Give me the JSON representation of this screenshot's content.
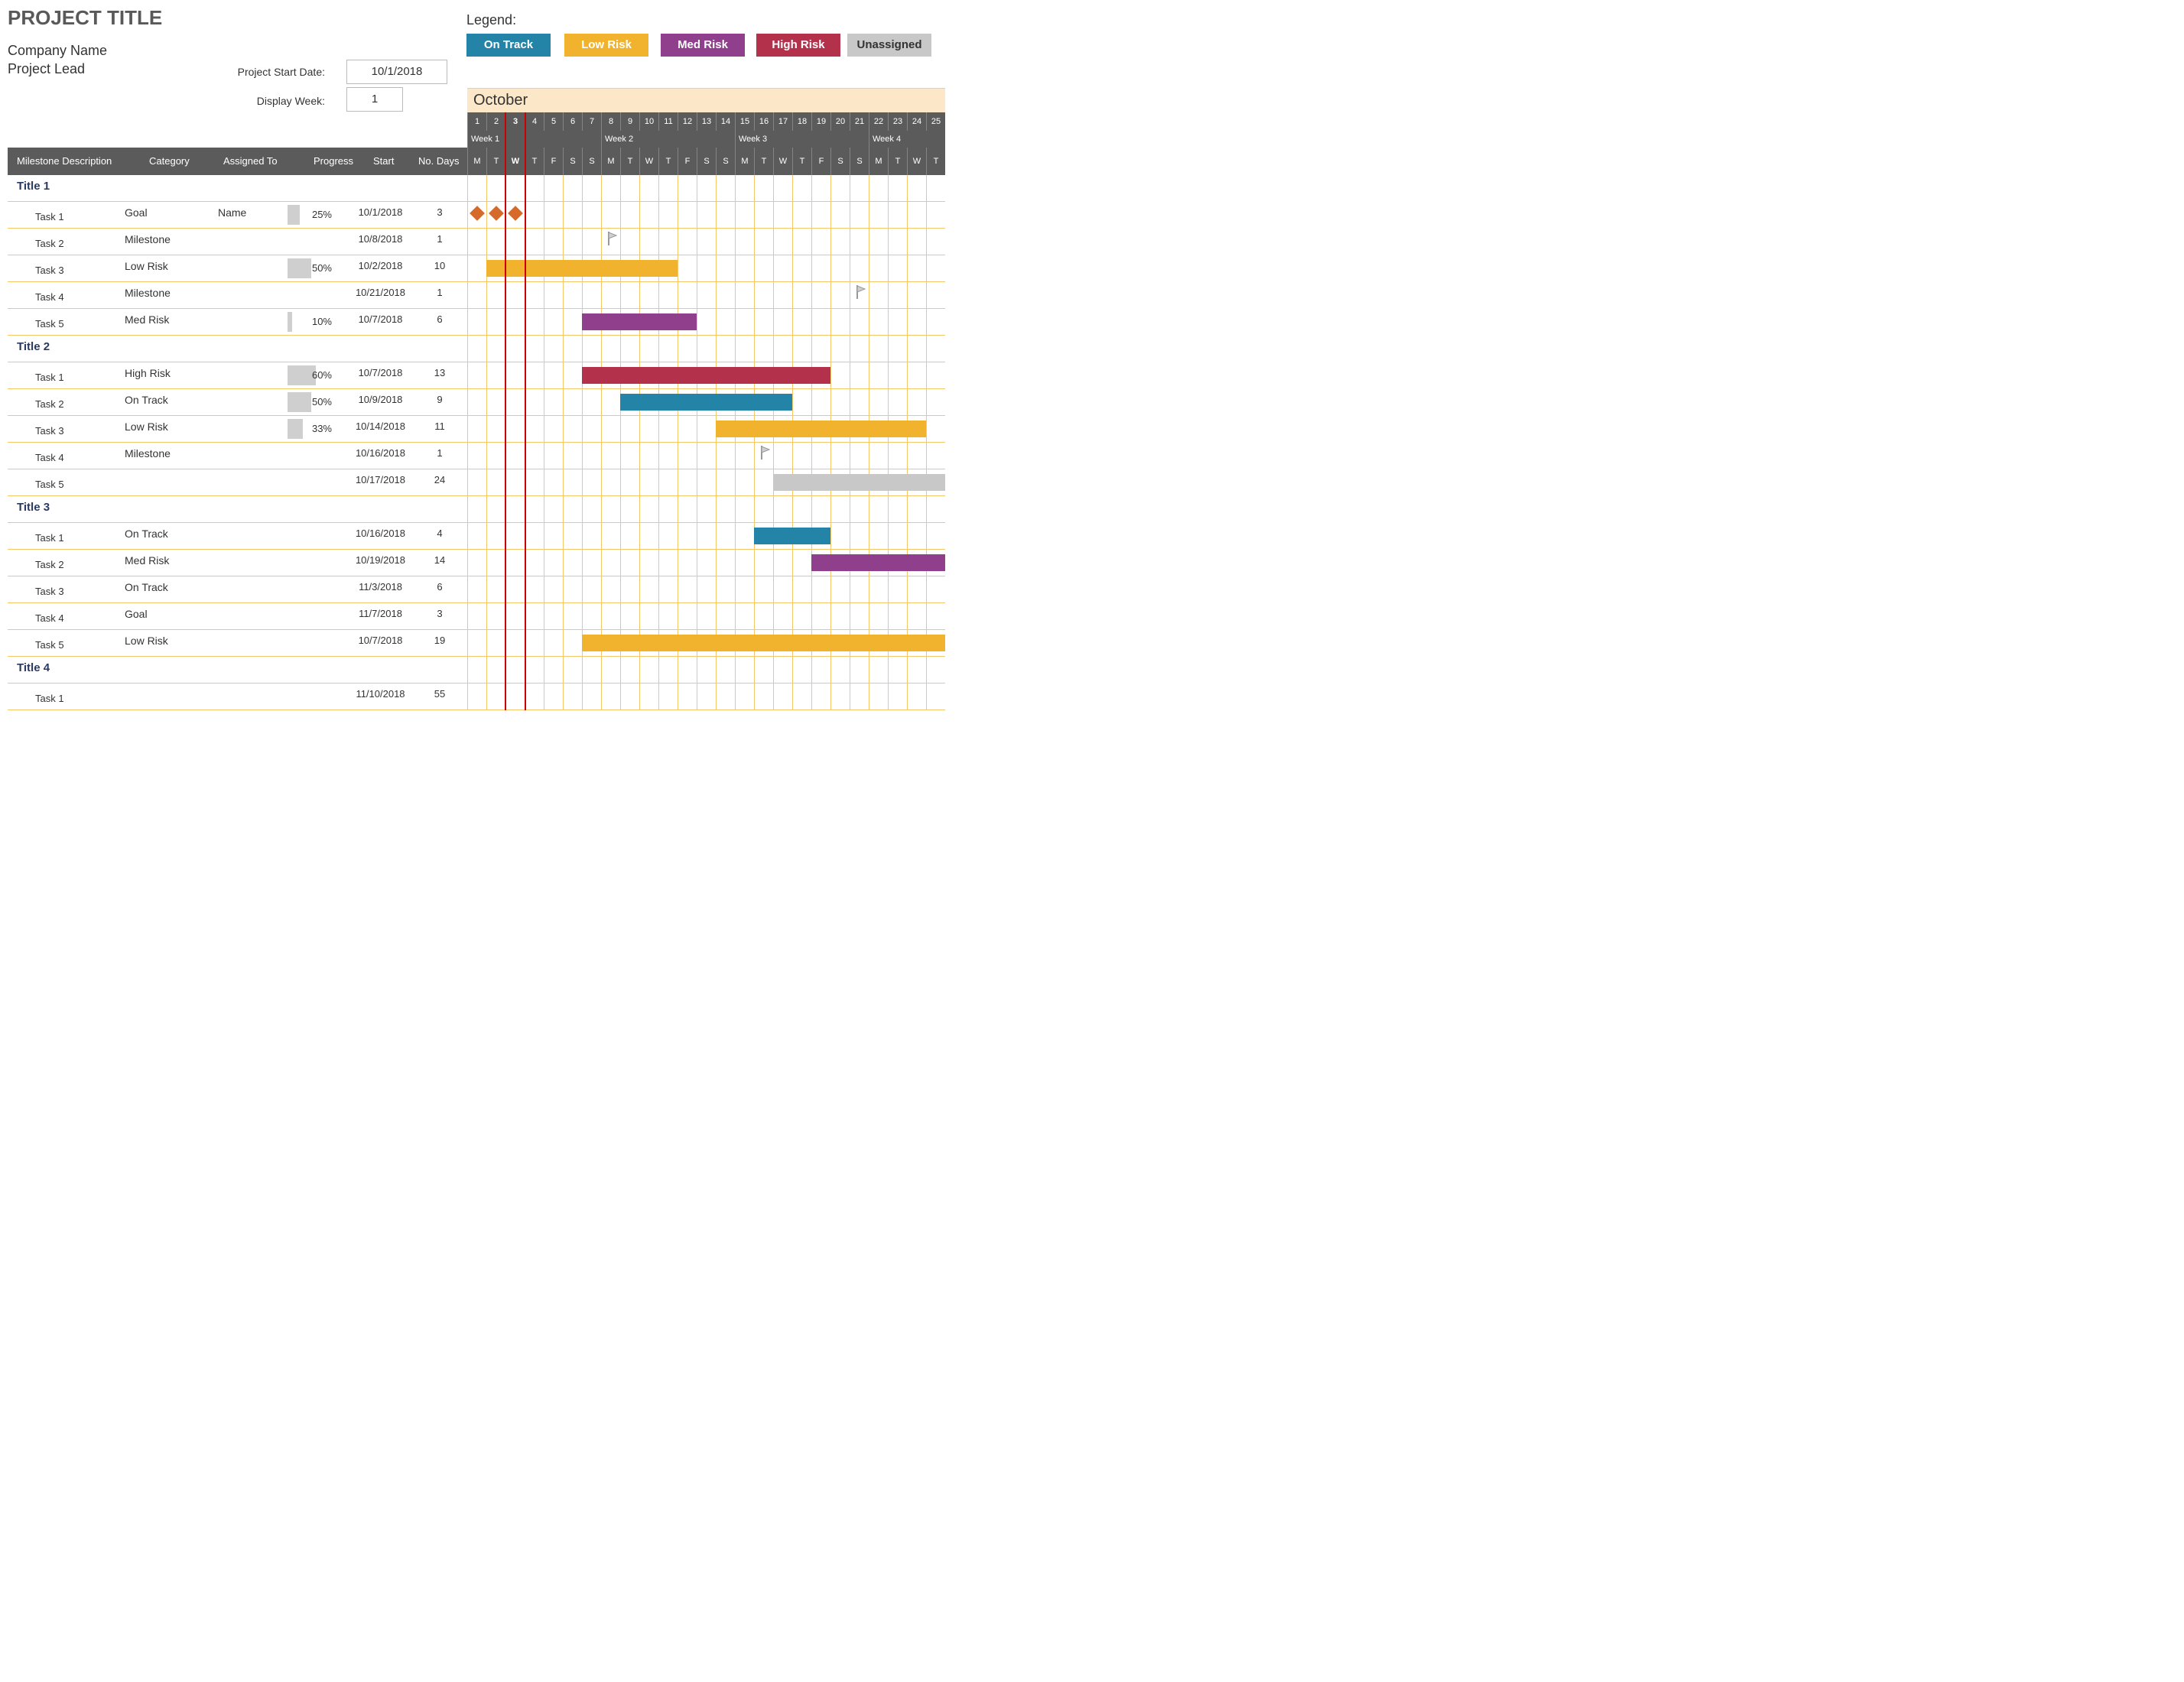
{
  "header": {
    "title": "PROJECT TITLE",
    "company": "Company Name",
    "lead": "Project Lead",
    "start_label": "Project Start Date:",
    "week_label": "Display Week:",
    "start_value": "10/1/2018",
    "week_value": "1",
    "legend_label": "Legend:",
    "legend": [
      "On Track",
      "Low Risk",
      "Med Risk",
      "High Risk",
      "Unassigned"
    ],
    "month": "October"
  },
  "colors": {
    "on_track": "#2484a8",
    "low_risk": "#f1b32d",
    "med_risk": "#8f3f8c",
    "high_risk": "#b4314c",
    "unassigned": "#c8c8c8",
    "goal": "#d56a2a"
  },
  "columns": {
    "c0": "Milestone Description",
    "c1": "Category",
    "c2": "Assigned To",
    "c3": "Progress",
    "c4": "Start",
    "c5": "No. Days"
  },
  "calendar": {
    "first_day_number": 1,
    "visible_days": 25,
    "day_width": 25,
    "today_day_index": 2,
    "week_labels": [
      "Week 1",
      "Week 2",
      "Week 3",
      "Week 4"
    ],
    "dow": [
      "M",
      "T",
      "W",
      "T",
      "F",
      "S",
      "S"
    ]
  },
  "chart_data": {
    "type": "gantt",
    "xlabel": "October 2018 (days 1–25)",
    "x_range": [
      1,
      25
    ],
    "sections": [
      {
        "title": "Title 1",
        "tasks": [
          {
            "name": "Task 1",
            "category": "Goal",
            "assigned": "Name",
            "progress": 25,
            "start": "10/1/2018",
            "days": 3,
            "start_day": 1,
            "render": "goal"
          },
          {
            "name": "Task 2",
            "category": "Milestone",
            "assigned": "",
            "progress": null,
            "start": "10/8/2018",
            "days": 1,
            "start_day": 8,
            "render": "milestone"
          },
          {
            "name": "Task 3",
            "category": "Low Risk",
            "assigned": "",
            "progress": 50,
            "start": "10/2/2018",
            "days": 10,
            "start_day": 2,
            "render": "bar",
            "color": "low_risk"
          },
          {
            "name": "Task 4",
            "category": "Milestone",
            "assigned": "",
            "progress": null,
            "start": "10/21/2018",
            "days": 1,
            "start_day": 21,
            "render": "milestone"
          },
          {
            "name": "Task 5",
            "category": "Med Risk",
            "assigned": "",
            "progress": 10,
            "start": "10/7/2018",
            "days": 6,
            "start_day": 7,
            "render": "bar",
            "color": "med_risk"
          }
        ]
      },
      {
        "title": "Title 2",
        "tasks": [
          {
            "name": "Task 1",
            "category": "High Risk",
            "assigned": "",
            "progress": 60,
            "start": "10/7/2018",
            "days": 13,
            "start_day": 7,
            "render": "bar",
            "color": "high_risk"
          },
          {
            "name": "Task 2",
            "category": "On Track",
            "assigned": "",
            "progress": 50,
            "start": "10/9/2018",
            "days": 9,
            "start_day": 9,
            "render": "bar",
            "color": "on_track"
          },
          {
            "name": "Task 3",
            "category": "Low Risk",
            "assigned": "",
            "progress": 33,
            "start": "10/14/2018",
            "days": 11,
            "start_day": 14,
            "render": "bar",
            "color": "low_risk"
          },
          {
            "name": "Task 4",
            "category": "Milestone",
            "assigned": "",
            "progress": null,
            "start": "10/16/2018",
            "days": 1,
            "start_day": 16,
            "render": "milestone"
          },
          {
            "name": "Task 5",
            "category": "",
            "assigned": "",
            "progress": null,
            "start": "10/17/2018",
            "days": 24,
            "start_day": 17,
            "render": "bar",
            "color": "unassigned"
          }
        ]
      },
      {
        "title": "Title 3",
        "tasks": [
          {
            "name": "Task 1",
            "category": "On Track",
            "assigned": "",
            "progress": null,
            "start": "10/16/2018",
            "days": 4,
            "start_day": 16,
            "render": "bar",
            "color": "on_track"
          },
          {
            "name": "Task 2",
            "category": "Med Risk",
            "assigned": "",
            "progress": null,
            "start": "10/19/2018",
            "days": 14,
            "start_day": 19,
            "render": "bar",
            "color": "med_risk"
          },
          {
            "name": "Task 3",
            "category": "On Track",
            "assigned": "",
            "progress": null,
            "start": "11/3/2018",
            "days": 6,
            "start_day": 34,
            "render": "bar",
            "color": "on_track"
          },
          {
            "name": "Task 4",
            "category": "Goal",
            "assigned": "",
            "progress": null,
            "start": "11/7/2018",
            "days": 3,
            "start_day": 38,
            "render": "goal"
          },
          {
            "name": "Task 5",
            "category": "Low Risk",
            "assigned": "",
            "progress": null,
            "start": "10/7/2018",
            "days": 19,
            "start_day": 7,
            "render": "bar",
            "color": "low_risk"
          }
        ]
      },
      {
        "title": "Title 4",
        "tasks": [
          {
            "name": "Task 1",
            "category": "",
            "assigned": "",
            "progress": null,
            "start": "11/10/2018",
            "days": 55,
            "start_day": 41,
            "render": "bar",
            "color": "unassigned"
          }
        ]
      }
    ]
  }
}
